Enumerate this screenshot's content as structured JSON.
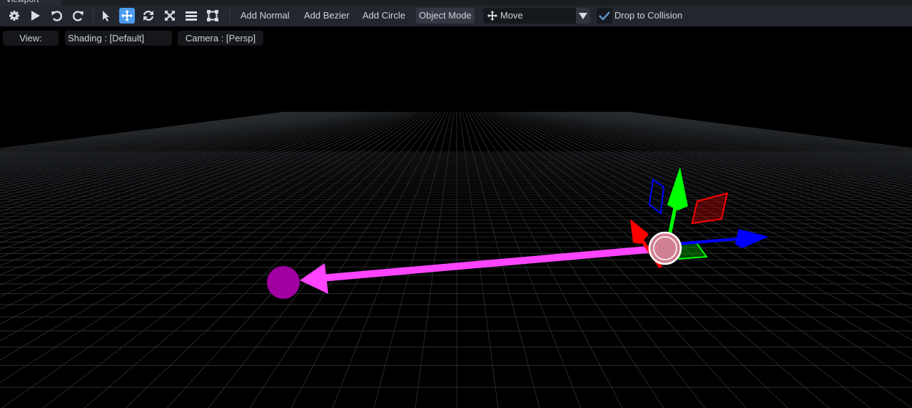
{
  "panel": {
    "tab": "Viewport"
  },
  "toolbar": {
    "icons": [
      "gear-icon",
      "play-icon",
      "undo-icon",
      "redo-icon",
      "select-icon",
      "move-icon",
      "rotate-icon",
      "scale-icon",
      "list-icon",
      "transform-box-icon"
    ],
    "add_normal": "Add Normal",
    "add_bezier": "Add Bezier",
    "add_circle": "Add Circle",
    "object_mode": "Object Mode",
    "transform_select": "Move",
    "drop_to_collision": "Drop to Collision",
    "drop_to_collision_checked": true
  },
  "viewbar": {
    "view": "View:",
    "shading": "Shading : [Default]",
    "camera": "Camera : [Persp]"
  },
  "colors": {
    "accent": "#4a9df0",
    "x_axis": "#ff0000",
    "y_axis": "#00ff00",
    "z_axis": "#0000ff",
    "normal": "#ff44ff",
    "point": "#a000a0"
  }
}
